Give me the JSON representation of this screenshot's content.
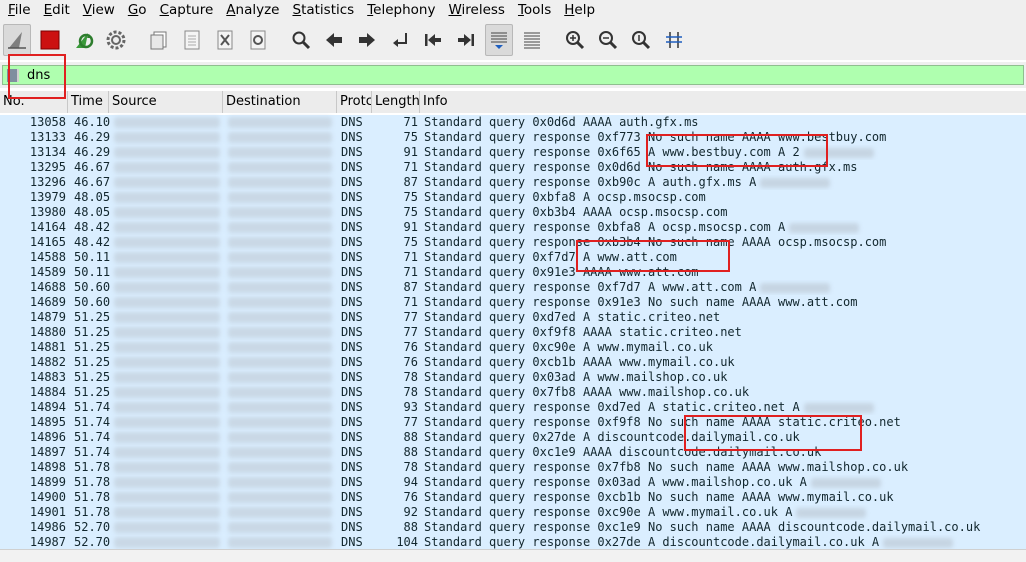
{
  "menu": [
    "File",
    "Edit",
    "View",
    "Go",
    "Capture",
    "Analyze",
    "Statistics",
    "Telephony",
    "Wireless",
    "Tools",
    "Help"
  ],
  "toolbar_icons": [
    "shark-fin-icon",
    "stop-square-icon",
    "restart-capture-icon",
    "capture-options-gear-icon",
    "open-file-icon",
    "save-file-icon",
    "close-file-icon",
    "reload-file-icon",
    "find-packet-icon",
    "go-back-arrow-icon",
    "go-forward-arrow-icon",
    "go-to-packet-icon",
    "first-packet-icon",
    "last-packet-icon",
    "autoscroll-icon",
    "colorize-icon",
    "zoom-in-icon",
    "zoom-out-icon",
    "zoom-normal-icon",
    "resize-columns-icon"
  ],
  "colors": {
    "filter_valid_bg": "#afffaf",
    "row_bg": "#daeeff",
    "highlight": "#e02020",
    "stop": "#cc1111"
  },
  "filter": {
    "value": "dns"
  },
  "columns": {
    "no": "No.",
    "time": "Time",
    "source": "Source",
    "destination": "Destination",
    "protocol": "Protc",
    "length": "Length",
    "info": "Info"
  },
  "packets": [
    {
      "no": "13058",
      "time": "46.10",
      "proto": "DNS",
      "len": "71",
      "info": "Standard query 0x0d6d AAAA auth.gfx.ms"
    },
    {
      "no": "13133",
      "time": "46.29",
      "proto": "DNS",
      "len": "75",
      "info": "Standard query response 0xf773 No such name AAAA www.bestbuy.com"
    },
    {
      "no": "13134",
      "time": "46.29",
      "proto": "DNS",
      "len": "91",
      "info": "Standard query response 0x6f65 A www.bestbuy.com A 2",
      "blur": true
    },
    {
      "no": "13295",
      "time": "46.67",
      "proto": "DNS",
      "len": "71",
      "info": "Standard query response 0x0d6d No such name AAAA auth.gfx.ms"
    },
    {
      "no": "13296",
      "time": "46.67",
      "proto": "DNS",
      "len": "87",
      "info": "Standard query response 0xb90c A auth.gfx.ms A",
      "blur": true
    },
    {
      "no": "13979",
      "time": "48.05",
      "proto": "DNS",
      "len": "75",
      "info": "Standard query 0xbfa8 A ocsp.msocsp.com"
    },
    {
      "no": "13980",
      "time": "48.05",
      "proto": "DNS",
      "len": "75",
      "info": "Standard query 0xb3b4 AAAA ocsp.msocsp.com"
    },
    {
      "no": "14164",
      "time": "48.42",
      "proto": "DNS",
      "len": "91",
      "info": "Standard query response 0xbfa8 A ocsp.msocsp.com A",
      "blur": true
    },
    {
      "no": "14165",
      "time": "48.42",
      "proto": "DNS",
      "len": "75",
      "info": "Standard query response 0xb3b4 No such name AAAA ocsp.msocsp.com"
    },
    {
      "no": "14588",
      "time": "50.11",
      "proto": "DNS",
      "len": "71",
      "info": "Standard query 0xf7d7 A www.att.com"
    },
    {
      "no": "14589",
      "time": "50.11",
      "proto": "DNS",
      "len": "71",
      "info": "Standard query 0x91e3 AAAA www.att.com"
    },
    {
      "no": "14688",
      "time": "50.60",
      "proto": "DNS",
      "len": "87",
      "info": "Standard query response 0xf7d7 A www.att.com A",
      "blur": true
    },
    {
      "no": "14689",
      "time": "50.60",
      "proto": "DNS",
      "len": "71",
      "info": "Standard query response 0x91e3 No such name AAAA www.att.com"
    },
    {
      "no": "14879",
      "time": "51.25",
      "proto": "DNS",
      "len": "77",
      "info": "Standard query 0xd7ed A static.criteo.net"
    },
    {
      "no": "14880",
      "time": "51.25",
      "proto": "DNS",
      "len": "77",
      "info": "Standard query 0xf9f8 AAAA static.criteo.net"
    },
    {
      "no": "14881",
      "time": "51.25",
      "proto": "DNS",
      "len": "76",
      "info": "Standard query 0xc90e A www.mymail.co.uk"
    },
    {
      "no": "14882",
      "time": "51.25",
      "proto": "DNS",
      "len": "76",
      "info": "Standard query 0xcb1b AAAA www.mymail.co.uk"
    },
    {
      "no": "14883",
      "time": "51.25",
      "proto": "DNS",
      "len": "78",
      "info": "Standard query 0x03ad A www.mailshop.co.uk"
    },
    {
      "no": "14884",
      "time": "51.25",
      "proto": "DNS",
      "len": "78",
      "info": "Standard query 0x7fb8 AAAA www.mailshop.co.uk"
    },
    {
      "no": "14894",
      "time": "51.74",
      "proto": "DNS",
      "len": "93",
      "info": "Standard query response 0xd7ed A static.criteo.net A",
      "blur": true
    },
    {
      "no": "14895",
      "time": "51.74",
      "proto": "DNS",
      "len": "77",
      "info": "Standard query response 0xf9f8 No such name AAAA static.criteo.net"
    },
    {
      "no": "14896",
      "time": "51.74",
      "proto": "DNS",
      "len": "88",
      "info": "Standard query 0x27de A discountcode.dailymail.co.uk"
    },
    {
      "no": "14897",
      "time": "51.74",
      "proto": "DNS",
      "len": "88",
      "info": "Standard query 0xc1e9 AAAA discountcode.dailymail.co.uk"
    },
    {
      "no": "14898",
      "time": "51.78",
      "proto": "DNS",
      "len": "78",
      "info": "Standard query response 0x7fb8 No such name AAAA www.mailshop.co.uk"
    },
    {
      "no": "14899",
      "time": "51.78",
      "proto": "DNS",
      "len": "94",
      "info": "Standard query response 0x03ad A www.mailshop.co.uk A",
      "blur": true
    },
    {
      "no": "14900",
      "time": "51.78",
      "proto": "DNS",
      "len": "76",
      "info": "Standard query response 0xcb1b No such name AAAA www.mymail.co.uk"
    },
    {
      "no": "14901",
      "time": "51.78",
      "proto": "DNS",
      "len": "92",
      "info": "Standard query response 0xc90e A www.mymail.co.uk A",
      "blur": true
    },
    {
      "no": "14986",
      "time": "52.70",
      "proto": "DNS",
      "len": "88",
      "info": "Standard query response 0xc1e9 No such name AAAA discountcode.dailymail.co.uk"
    },
    {
      "no": "14987",
      "time": "52.70",
      "proto": "DNS",
      "len": "104",
      "info": "Standard query response 0x27de A discountcode.dailymail.co.uk A",
      "blur": true
    }
  ]
}
